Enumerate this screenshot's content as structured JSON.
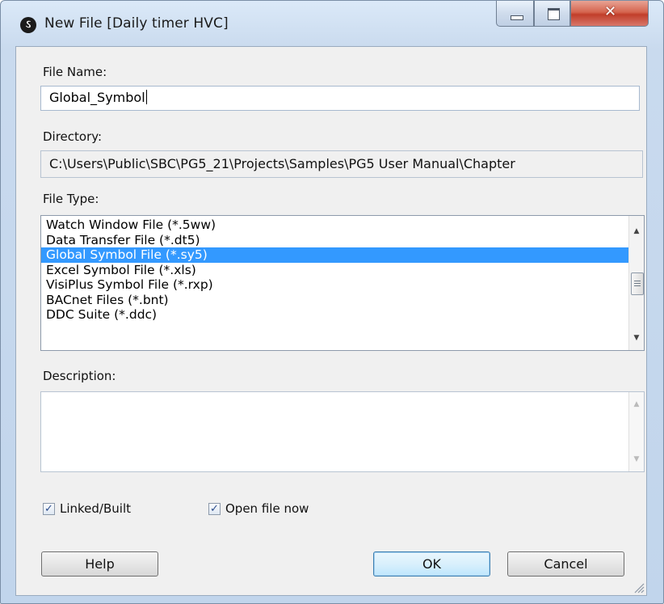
{
  "window": {
    "title": "New File [Daily timer HVC]",
    "app_icon": "saia-pg5-icon",
    "caption_buttons": {
      "minimize": "minimize-icon",
      "maximize": "maximize-icon",
      "close": "✕"
    }
  },
  "form": {
    "file_name": {
      "label": "File Name:",
      "value": "Global_Symbol"
    },
    "directory": {
      "label": "Directory:",
      "value": "C:\\Users\\Public\\SBC\\PG5_21\\Projects\\Samples\\PG5 User Manual\\Chapter"
    },
    "file_type": {
      "label": "File Type:",
      "items": [
        "Watch Window File (*.5ww)",
        "Data Transfer File (*.dt5)",
        "Global Symbol File (*.sy5)",
        "Excel Symbol File (*.xls)",
        "VisiPlus Symbol File (*.rxp)",
        "BACnet Files (*.bnt)",
        "DDC Suite (*.ddc)"
      ],
      "selected": "Global Symbol File (*.sy5)"
    },
    "description": {
      "label": "Description:",
      "value": ""
    },
    "linked_built": {
      "label": "Linked/Built",
      "checked": true
    },
    "open_file_now": {
      "label": "Open file now",
      "checked": true
    }
  },
  "buttons": {
    "help": "Help",
    "ok": "OK",
    "cancel": "Cancel"
  },
  "colors": {
    "selection": "#3399ff",
    "close_button": "#c13e2a",
    "dialog_bg": "#f0f0f0"
  }
}
